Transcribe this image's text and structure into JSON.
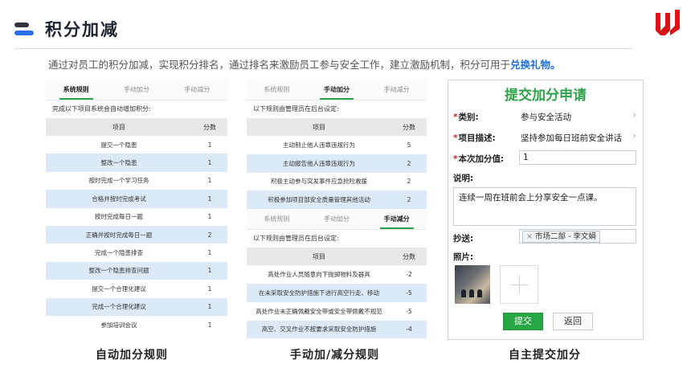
{
  "header": {
    "title": "积分加减",
    "intro_text": "通过对员工的积分加减，实现积分排名，通过排名来激励员工参与安全工作，建立激励机制，积分可用于",
    "intro_highlight": "兑换礼物。"
  },
  "colors": {
    "accent_green": "#2ea24a",
    "highlight_blue": "#1f6fe0",
    "row_blue": "#dceaf8",
    "logo_red": "#d8131a"
  },
  "panel1": {
    "tabs": [
      "系统规则",
      "手动加分",
      "手动减分"
    ],
    "active_tab": 0,
    "note": "完成以下项目系统会自动增加积分:",
    "col_item": "项目",
    "col_score": "分数",
    "rows": [
      {
        "item": "提交一个隐患",
        "score": "1"
      },
      {
        "item": "整改一个隐患",
        "score": "1"
      },
      {
        "item": "按时完成一个学习任务",
        "score": "1"
      },
      {
        "item": "合格并按时完成考试",
        "score": "1"
      },
      {
        "item": "按时完成每日一题",
        "score": "1"
      },
      {
        "item": "正确并按时完成每日一题",
        "score": "2"
      },
      {
        "item": "完成一个隐患排查",
        "score": "1"
      },
      {
        "item": "整改一个隐患排查问题",
        "score": "1"
      },
      {
        "item": "提交一个合理化建议",
        "score": "1"
      },
      {
        "item": "完成一个合理化建议",
        "score": "1"
      },
      {
        "item": "参加培训会议",
        "score": "1"
      }
    ],
    "caption": "自动加分规则"
  },
  "panel2": {
    "add": {
      "tabs": [
        "系统规则",
        "手动加分",
        "手动减分"
      ],
      "active_tab": 1,
      "note": "以下规则由管理员在后台设定:",
      "col_item": "项目",
      "col_score": "分数",
      "rows": [
        {
          "item": "主动制止他人违章违规行为",
          "score": "5"
        },
        {
          "item": "主动报告他人违章违规行为",
          "score": "2"
        },
        {
          "item": "积极主动参与突发事件应急抢险救援",
          "score": "2"
        },
        {
          "item": "积极参加项目部安全质量管理其他活动",
          "score": "2"
        }
      ]
    },
    "minus": {
      "tabs": [
        "系统规则",
        "手动加分",
        "手动减分"
      ],
      "active_tab": 2,
      "note": "以下规则由管理员在后台设定:",
      "col_item": "项目",
      "col_score": "分数",
      "rows": [
        {
          "item": "高处作业人员随意向下抛掷物料及器具",
          "score": "-2"
        },
        {
          "item": "在未采取安全防护措施下进行高空行走、移动",
          "score": "-5"
        },
        {
          "item": "高处作业未正确佩戴安全带或安全带佩戴不规范",
          "score": "-5"
        },
        {
          "item": "高空、交叉作业不按要求采取安全防护措施",
          "score": "-4"
        }
      ]
    },
    "caption": "手动加/减分规则"
  },
  "panel3": {
    "form_title": "提交加分申请",
    "category_label": "类别:",
    "category_value": "参与安全活动",
    "desc_label": "项目描述:",
    "desc_value": "坚持参加每日班前安全讲话",
    "points_label": "本次加分值:",
    "points_value": "1",
    "note_label": "说明:",
    "note_value": "连续一周在班前会上分享安全一点课。",
    "cc_label": "抄送:",
    "cc_tag": "市场二部 - 李文娟",
    "photo_label": "照片:",
    "submit_label": "提交",
    "back_label": "返回",
    "caption": "自主提交加分"
  }
}
